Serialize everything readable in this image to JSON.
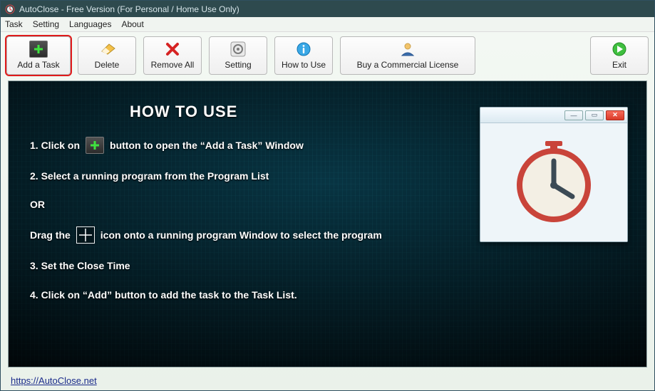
{
  "titlebar": {
    "text": "AutoClose - Free Version (For Personal / Home Use Only)"
  },
  "menu": {
    "task": "Task",
    "setting": "Setting",
    "languages": "Languages",
    "about": "About"
  },
  "toolbar": {
    "add": "Add a Task",
    "delete": "Delete",
    "removeAll": "Remove All",
    "setting": "Setting",
    "howTo": "How to Use",
    "buy": "Buy a Commercial License",
    "exit": "Exit"
  },
  "howto": {
    "heading": "HOW TO USE",
    "step1_a": "1. Click on",
    "step1_b": "button to open the “Add a Task” Window",
    "step2": "2. Select a running program from the Program List",
    "or": "OR",
    "drag_a": "Drag the",
    "drag_b": "icon onto a running program Window to select the program",
    "step3": "3. Set the Close Time",
    "step4": "4. Click on “Add” button to add the task to the Task List."
  },
  "footer": {
    "link": "https://AutoClose.net"
  }
}
